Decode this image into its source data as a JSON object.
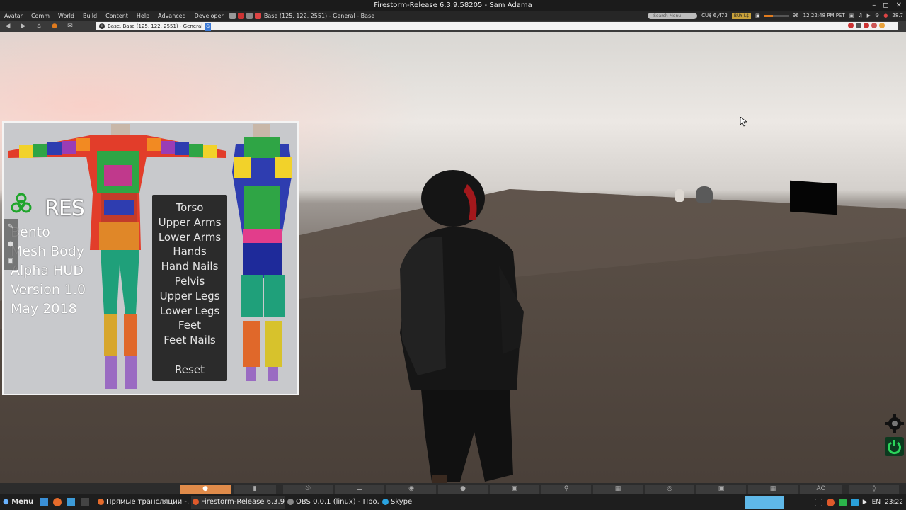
{
  "window": {
    "title": "Firestorm-Release 6.3.9.58205 - Sam Adama"
  },
  "menubar": {
    "items": [
      "Avatar",
      "Comm",
      "World",
      "Build",
      "Content",
      "Help",
      "Advanced",
      "Developer"
    ],
    "location": "Base (125, 122, 2551) - General - Base",
    "search_placeholder": "Search Menu",
    "balance": "CU$ 6,473",
    "buy_label": "BUY L$",
    "fps": "96",
    "time": "12:22:48 PM PST",
    "fps_fraction": 0.35,
    "right_value": "28.7"
  },
  "navbar": {
    "address": "Base, Base (125, 122, 2551) - General",
    "badge": "G"
  },
  "hud": {
    "brand": "RES",
    "lines": [
      "Bento",
      "Mesh Body",
      "Alpha HUD",
      "Version 1.0",
      "May 2018"
    ],
    "menu": [
      "Torso",
      "Upper Arms",
      "Lower Arms",
      "Hands",
      "Hand Nails",
      "Pelvis",
      "Upper Legs",
      "Lower Legs",
      "Feet",
      "Feet Nails"
    ],
    "reset": "Reset"
  },
  "toolbar": {
    "ao_label": "AO"
  },
  "taskbar": {
    "menu": "Menu",
    "tasks": [
      "Прямые трансляции -...",
      "Firestorm-Release 6.3.9...",
      "OBS 0.0.1 (linux) - Про...",
      "Skype"
    ],
    "lang": "EN",
    "clock": "23:22"
  },
  "colors": {
    "accent_orange": "#e08b4a",
    "power_green": "#2bd45a",
    "badge_blue": "#3c7ad6"
  }
}
